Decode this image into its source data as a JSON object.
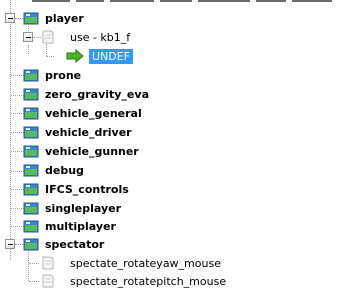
{
  "tree": {
    "player": {
      "label": "player",
      "use_node": "use - kb1_f",
      "value": "UNDEF"
    },
    "groups": [
      "prone",
      "zero_gravity_eva",
      "vehicle_general",
      "vehicle_driver",
      "vehicle_gunner",
      "debug",
      "IFCS_controls",
      "singleplayer",
      "multiplayer"
    ],
    "spectator": {
      "label": "spectator",
      "children": [
        "spectate_rotateyaw_mouse",
        "spectate_rotatepitch_mouse"
      ]
    }
  }
}
